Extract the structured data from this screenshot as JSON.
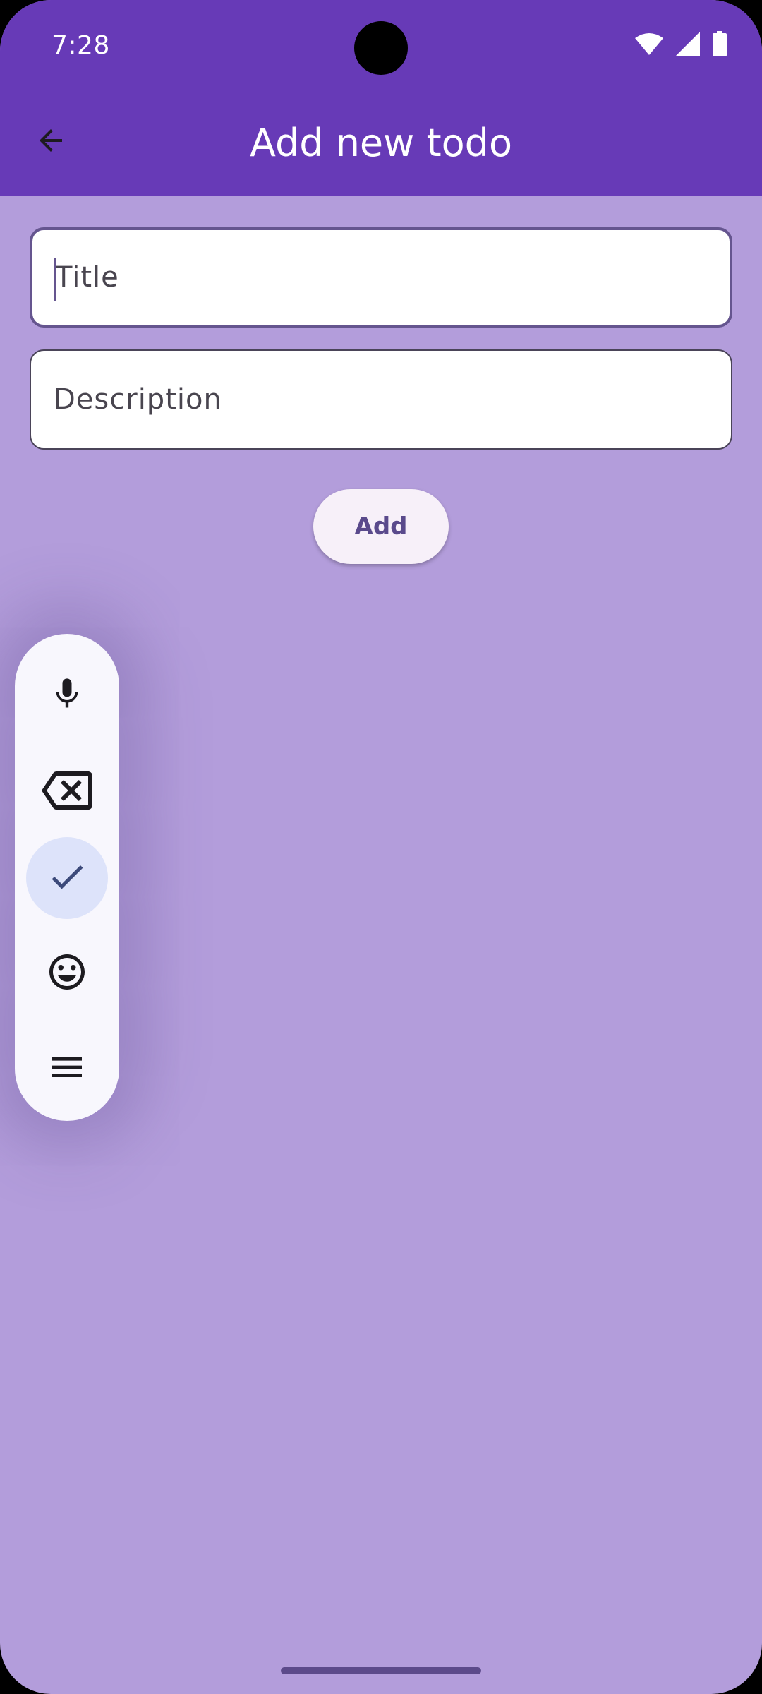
{
  "status_bar": {
    "time": "7:28"
  },
  "app_bar": {
    "title": "Add new todo"
  },
  "form": {
    "title_placeholder": "Title",
    "title_value": "",
    "description_placeholder": "Description",
    "description_value": "",
    "add_label": "Add"
  },
  "floating_toolbar": {
    "items": [
      "mic-icon",
      "backspace-icon",
      "check-icon",
      "emoji-icon",
      "menu-icon"
    ],
    "active": "check-icon"
  },
  "colors": {
    "app_bar": "#673ab7",
    "background": "#b39ddb",
    "field_border_focused": "#65558f",
    "toolbar": "#f8f7fd",
    "active_tool": "#dde3fa"
  }
}
